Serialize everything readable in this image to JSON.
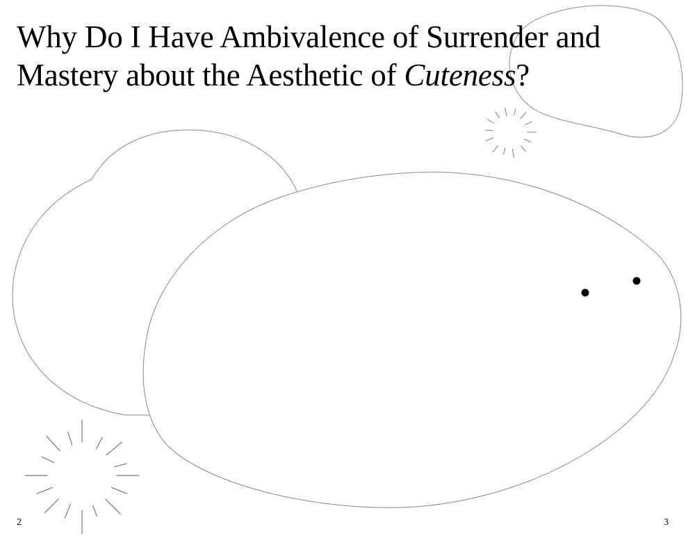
{
  "title": {
    "line1": "Why Do I Have Ambivalence of Surrender and",
    "line2_prefix": "Mastery about the Aesthetic of ",
    "line2_emphasis": "Cuteness",
    "line2_suffix": "?"
  },
  "page_numbers": {
    "left": "2",
    "right": "3"
  },
  "colors": {
    "outline": "#888888",
    "sparkle": "#777777",
    "eyes": "#000000"
  }
}
